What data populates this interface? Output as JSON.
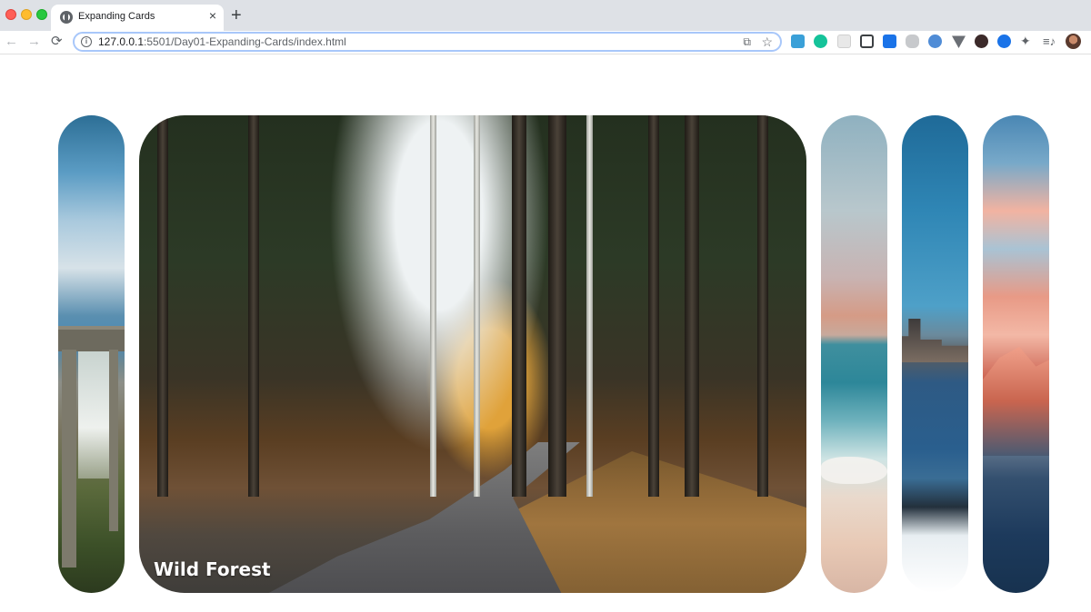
{
  "browser": {
    "tab_title": "Expanding Cards",
    "tab_close": "×",
    "new_tab": "+",
    "url_host": "127.0.0.1",
    "url_rest": ":5501/Day01-Expanding-Cards/index.html",
    "info_icon": "i",
    "cast_icon": "⧉",
    "star_icon": "☆",
    "nav_back": "←",
    "nav_forward": "→",
    "nav_reload": "⟳",
    "extensions_icon": "✦",
    "reading_list_icon": "≡♪"
  },
  "cards": [
    {
      "id": "bridge",
      "title": "",
      "active": false
    },
    {
      "id": "forest",
      "title": "Wild Forest",
      "active": true
    },
    {
      "id": "beach",
      "title": "",
      "active": false
    },
    {
      "id": "city",
      "title": "",
      "active": false
    },
    {
      "id": "mountain",
      "title": "",
      "active": false
    }
  ]
}
